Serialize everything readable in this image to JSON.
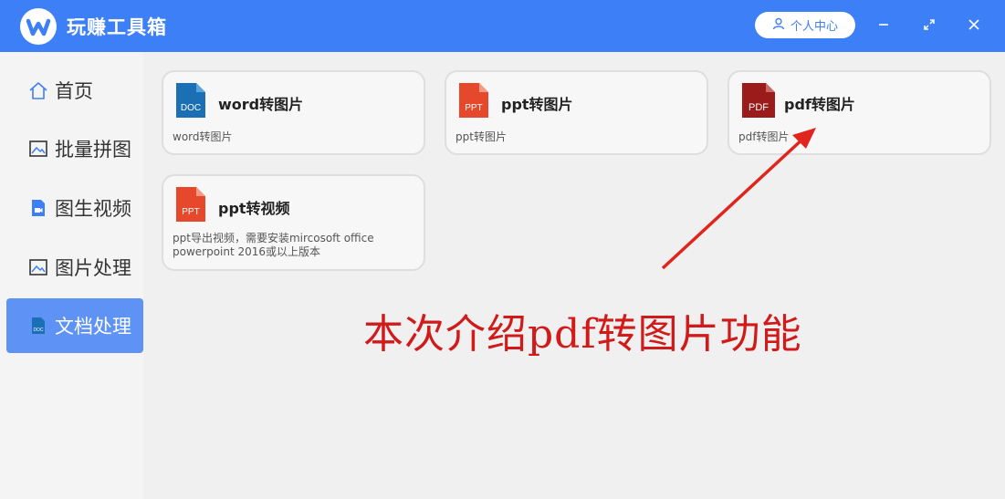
{
  "app": {
    "title": "玩赚工具箱",
    "accent": "#3d7ff6"
  },
  "titlebar": {
    "user_center": "个人中心"
  },
  "sidebar": {
    "items": [
      {
        "label": "首页",
        "icon": "home-icon",
        "active": false
      },
      {
        "label": "批量拼图",
        "icon": "image-icon",
        "active": false
      },
      {
        "label": "图生视频",
        "icon": "video-doc-icon",
        "active": false
      },
      {
        "label": "图片处理",
        "icon": "image-icon",
        "active": false
      },
      {
        "label": "文档处理",
        "icon": "doc-icon",
        "active": true
      }
    ]
  },
  "cards": [
    {
      "title": "word转图片",
      "desc": "word转图片",
      "icon_label": "DOC",
      "icon_color": "#1b6fb5"
    },
    {
      "title": "ppt转图片",
      "desc": "ppt转图片",
      "icon_label": "PPT",
      "icon_color": "#e5482a"
    },
    {
      "title": "pdf转图片",
      "desc": "pdf转图片",
      "icon_label": "PDF",
      "icon_color": "#9b1b1b"
    },
    {
      "title": "ppt转视频",
      "desc": "ppt导出视频，需要安装mircosoft office powerpoint 2016或以上版本",
      "icon_label": "PPT",
      "icon_color": "#e5482a"
    }
  ],
  "annotation": {
    "text": "本次介绍pdf转图片功能",
    "color": "#d11a1a"
  }
}
